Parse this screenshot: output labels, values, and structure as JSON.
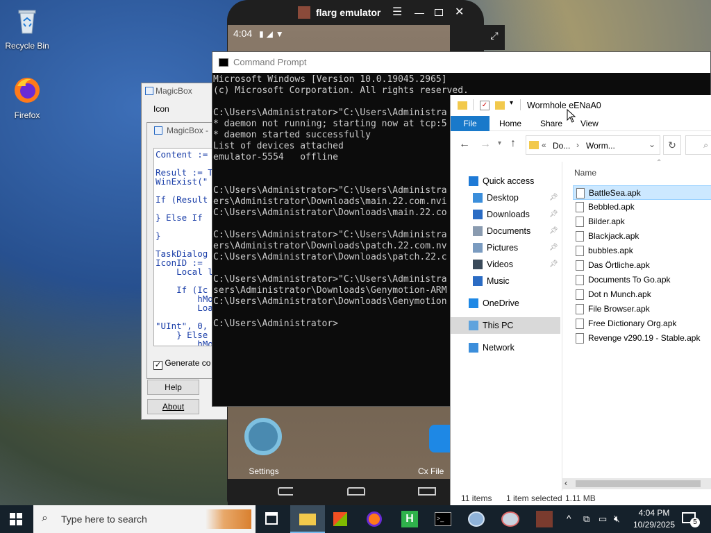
{
  "desktop": {
    "icons": [
      {
        "label": "Recycle Bin"
      },
      {
        "label": "Firefox"
      }
    ]
  },
  "magicbox": {
    "back_title": "MagicBox",
    "icon_label": "Icon",
    "front_title": "MagicBox -",
    "code_lines": [
      "Content :=",
      "",
      "Result := T",
      "WinExist(\"",
      "",
      "If (Result",
      "",
      "} Else If",
      "",
      "}",
      "",
      "TaskDialog",
      "IconID := ",
      "    Local l",
      "",
      "    If (Ic",
      "        hMo",
      "        Loa",
      "",
      "\"UInt\", 0,",
      "    } Else",
      "        hMo"
    ],
    "generate_label": "Generate co",
    "help_label": "Help",
    "about_label": "About"
  },
  "emulator": {
    "title": "flarg emulator",
    "clock": "4:04",
    "apps": [
      {
        "label": "Settings"
      },
      {
        "label": "Cx File"
      }
    ]
  },
  "cmd": {
    "title": "Command Prompt",
    "lines": [
      "Microsoft Windows [Version 10.0.19045.2965]",
      "(c) Microsoft Corporation. All rights reserved.",
      "",
      "C:\\Users\\Administrator>\"C:\\Users\\Administra",
      "* daemon not running; starting now at tcp:5",
      "* daemon started successfully",
      "List of devices attached",
      "emulator-5554   offline",
      "",
      "",
      "C:\\Users\\Administrator>\"C:\\Users\\Administra",
      "ers\\Administrator\\Downloads\\main.22.com.nvi",
      "C:\\Users\\Administrator\\Downloads\\main.22.co",
      "",
      "C:\\Users\\Administrator>\"C:\\Users\\Administra",
      "ers\\Administrator\\Downloads\\patch.22.com.nv",
      "C:\\Users\\Administrator\\Downloads\\patch.22.c",
      "",
      "C:\\Users\\Administrator>\"C:\\Users\\Administra",
      "sers\\Administrator\\Downloads\\Genymotion-ARM",
      "C:\\Users\\Administrator\\Downloads\\Genymotion",
      "",
      "C:\\Users\\Administrator>"
    ]
  },
  "explorer": {
    "title": "Wormhole eENaA0",
    "tabs": [
      "File",
      "Home",
      "Share",
      "View"
    ],
    "address": {
      "part1": "Do...",
      "part2": "Worm..."
    },
    "column_name": "Name",
    "nav": [
      {
        "label": "Quick access",
        "pinned": false
      },
      {
        "label": "Desktop",
        "pinned": true
      },
      {
        "label": "Downloads",
        "pinned": true
      },
      {
        "label": "Documents",
        "pinned": true
      },
      {
        "label": "Pictures",
        "pinned": true
      },
      {
        "label": "Videos",
        "pinned": true
      },
      {
        "label": "Music",
        "pinned": false
      },
      {
        "label": "OneDrive",
        "pinned": false
      },
      {
        "label": "This PC",
        "pinned": false
      },
      {
        "label": "Network",
        "pinned": false
      }
    ],
    "files": [
      "BattleSea.apk",
      "Bebbled.apk",
      "Bilder.apk",
      "Blackjack.apk",
      "bubbles.apk",
      "Das Örtliche.apk",
      "Documents To Go.apk",
      "Dot n Munch.apk",
      "File Browser.apk",
      "Free Dictionary Org.apk",
      "Revenge v290.19 - Stable.apk"
    ],
    "status": {
      "count": "11 items",
      "selected": "1 item selected",
      "size": "1.11 MB"
    }
  },
  "taskbar": {
    "search_placeholder": "Type here to search",
    "time": "4:04 PM",
    "date": "10/29/2025",
    "notification_count": "5"
  },
  "colors": {
    "accent": "#0078d7",
    "taskbar": "#15212b",
    "cmd_bg": "#0c0c0c",
    "code_text": "#1a3ea8"
  }
}
